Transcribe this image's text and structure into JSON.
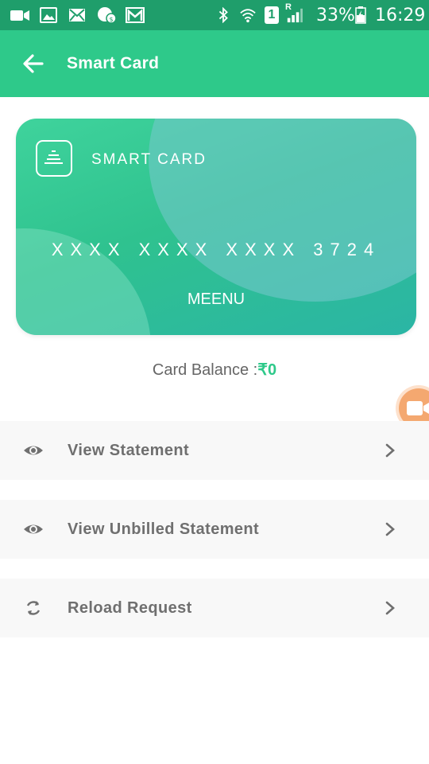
{
  "status_bar": {
    "battery": "33%",
    "time": "16:29",
    "sim": "1",
    "roaming": "R",
    "left_icons": [
      "video-call-icon",
      "image-icon",
      "mail-icon",
      "chat-icon",
      "gmail-icon"
    ],
    "right_icons": [
      "bluetooth-icon",
      "wifi-icon",
      "sim-icon",
      "signal-icon",
      "battery-icon"
    ]
  },
  "header": {
    "title": "Smart Card",
    "back_icon": "arrow-left-icon",
    "background": "#2ec98a"
  },
  "card": {
    "brand": "SMART CARD",
    "number": "XXXX XXXX XXXX 3724",
    "holder": "MEENU",
    "logo_icon": "card-logo-icon"
  },
  "balance": {
    "label": "Card Balance :",
    "value": "₹0",
    "accent": "#2ec98a"
  },
  "menu": [
    {
      "label": "View Statement",
      "icon": "eye-icon"
    },
    {
      "label": "View Unbilled Statement",
      "icon": "eye-icon"
    },
    {
      "label": "Reload Request",
      "icon": "refresh-icon"
    }
  ],
  "floating_button": {
    "icon": "video-camera-icon",
    "color": "#f4a870"
  }
}
